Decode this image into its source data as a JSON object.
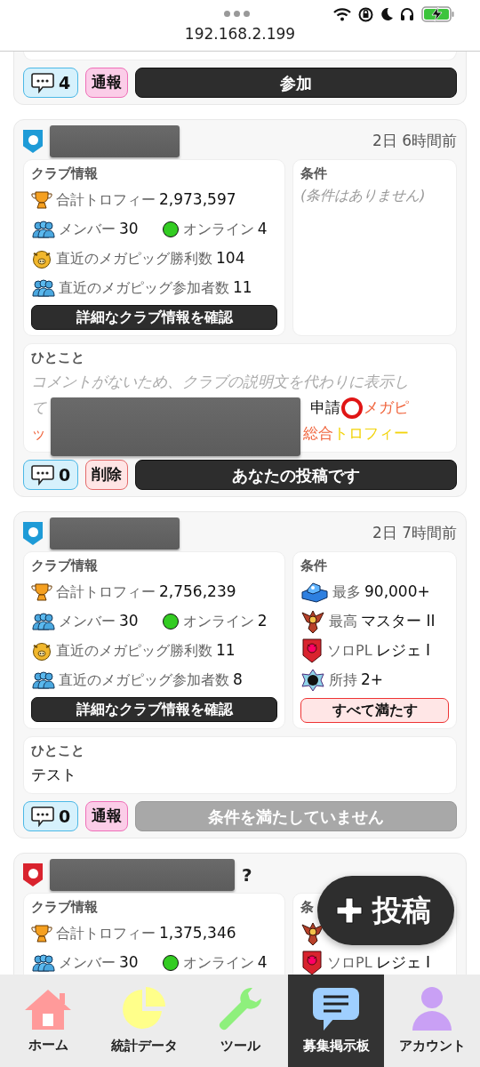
{
  "browser": {
    "url": "192.168.2.199"
  },
  "posts": [
    {
      "cut_top": true,
      "actions": {
        "comments": "4",
        "secondary": {
          "kind": "report",
          "label": "通報"
        },
        "primary": {
          "label": "参加",
          "disabled": false
        }
      }
    },
    {
      "color": "#1e9bd7",
      "name_hidden": true,
      "time": "2日 6時間前",
      "club_info": {
        "title": "クラブ情報",
        "rows": [
          {
            "kind": "trophy",
            "label": "合計トロフィー",
            "value": "2,973,597"
          },
          {
            "kind": "members",
            "label": "メンバー",
            "value": "30",
            "online_label": "オンライン",
            "online_value": "4"
          },
          {
            "kind": "pig",
            "label": "直近のメガピッグ勝利数",
            "value": "104"
          },
          {
            "kind": "people",
            "label": "直近のメガピッグ参加者数",
            "value": "11"
          }
        ],
        "button": "詳細なクラブ情報を確認"
      },
      "conditions": {
        "title": "条件",
        "empty_text": "(条件はありません)"
      },
      "comment": {
        "title": "ひとこと",
        "redacted": true,
        "lines": [
          {
            "left": [
              {
                "text": "コメントがないため、クラブの説明文を代わりに表示し",
                "color": "#aaaaaa",
                "italic": true
              }
            ]
          },
          {
            "left": [
              {
                "text": "て",
                "color": "#aaaaaa",
                "italic": true
              }
            ],
            "right": [
              {
                "text": "申請",
                "color": "#111111",
                "italic": false
              },
              {
                "kind": "ring"
              },
              {
                "text": "メガピ",
                "color": "#f0643c",
                "italic": false
              }
            ]
          },
          {
            "left": [
              {
                "text": "ッ",
                "color": "#f0643c",
                "italic": false
              }
            ],
            "right": [
              {
                "text": "総合",
                "color": "#f0643c",
                "italic": false
              },
              {
                "text": "トロフィー",
                "color": "#f2d40c",
                "italic": false
              }
            ]
          }
        ]
      },
      "actions": {
        "comments": "0",
        "secondary": {
          "kind": "delete",
          "label": "削除"
        },
        "primary": {
          "label": "あなたの投稿です",
          "disabled": false
        }
      }
    },
    {
      "color": "#1e9bd7",
      "name_hidden": true,
      "time": "2日 7時間前",
      "club_info": {
        "title": "クラブ情報",
        "rows": [
          {
            "kind": "trophy",
            "label": "合計トロフィー",
            "value": "2,756,239"
          },
          {
            "kind": "members",
            "label": "メンバー",
            "value": "30",
            "online_label": "オンライン",
            "online_value": "2"
          },
          {
            "kind": "pig",
            "label": "直近のメガピッグ勝利数",
            "value": "11"
          },
          {
            "kind": "people",
            "label": "直近のメガピッグ参加者数",
            "value": "8"
          }
        ],
        "button": "詳細なクラブ情報を確認"
      },
      "conditions": {
        "title": "条件",
        "rows": [
          {
            "kind": "max",
            "label": "最多",
            "value": "90,000+"
          },
          {
            "kind": "highest",
            "label": "最高",
            "value": "マスター II"
          },
          {
            "kind": "solo",
            "label": "ソロPL",
            "value": "レジェ I"
          },
          {
            "kind": "owned",
            "label": "所持",
            "value": "2+"
          }
        ],
        "status": "すべて満たす"
      },
      "comment": {
        "title": "ひとこと",
        "lines": [
          {
            "left": [
              {
                "text": "テスト",
                "color": "#111111",
                "italic": false
              }
            ]
          }
        ]
      },
      "actions": {
        "comments": "0",
        "secondary": {
          "kind": "report",
          "label": "通報"
        },
        "primary": {
          "label": "条件を満たしていません",
          "disabled": true
        }
      }
    },
    {
      "color": "#d9232e",
      "name_hidden": true,
      "name_suffix": "?",
      "club_info": {
        "title": "クラブ情報",
        "rows": [
          {
            "kind": "trophy",
            "label": "合計トロフィー",
            "value": "1,375,346"
          },
          {
            "kind": "members",
            "label": "メンバー",
            "value": "30",
            "online_label": "オンライン",
            "online_value": "4"
          }
        ]
      },
      "conditions": {
        "title": "条",
        "rows": [
          {
            "kind": "highest"
          },
          {
            "kind": "solo",
            "label": "ソロPL",
            "value": "レジェ I"
          }
        ]
      }
    }
  ],
  "fab": {
    "label": "投稿"
  },
  "nav": [
    {
      "label": "ホーム",
      "selected": false
    },
    {
      "label": "統計データ",
      "selected": false
    },
    {
      "label": "ツール",
      "selected": false
    },
    {
      "label": "募集掲示板",
      "selected": true
    },
    {
      "label": "アカウント",
      "selected": false
    }
  ]
}
